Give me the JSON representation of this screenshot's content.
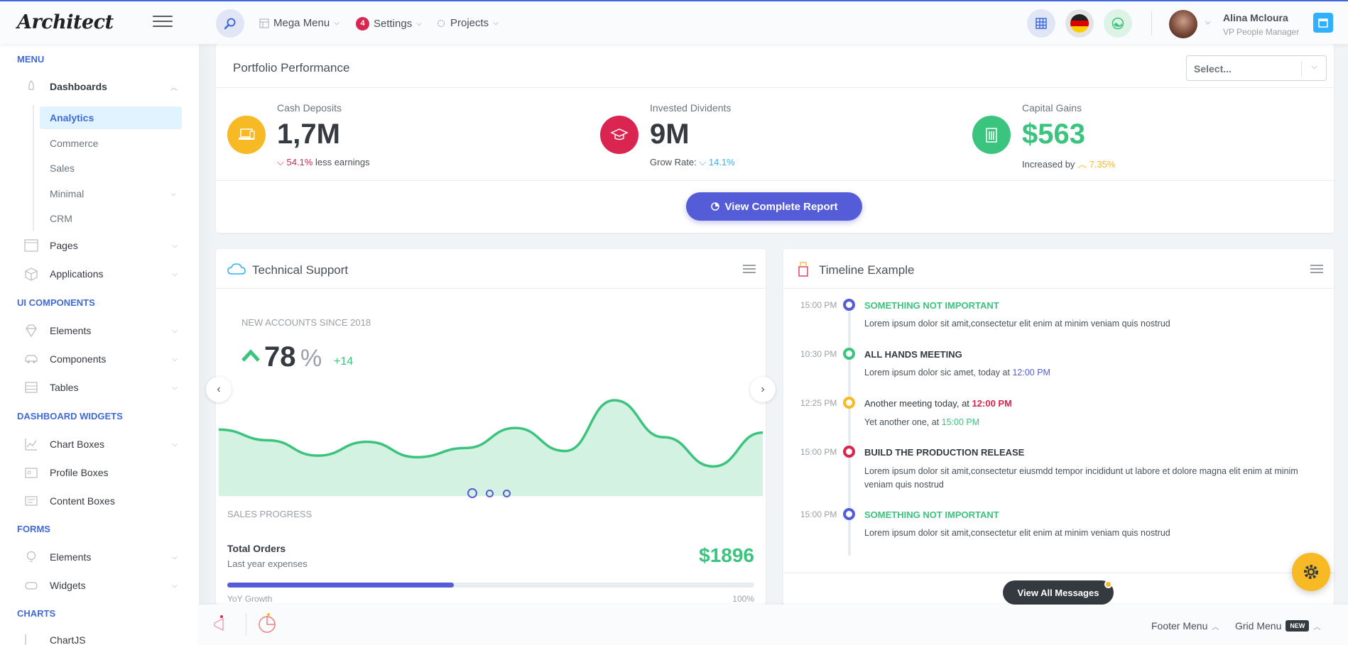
{
  "app": {
    "logo": "Architect"
  },
  "header": {
    "mega_menu": "Mega Menu",
    "settings": "Settings",
    "settings_badge": "4",
    "projects": "Projects",
    "user_name": "Alina Mcloura",
    "user_role": "VP People Manager"
  },
  "sidebar": {
    "sections": {
      "menu": "MENU",
      "ui_components": "UI COMPONENTS",
      "dashboard_widgets": "DASHBOARD WIDGETS",
      "forms": "FORMS",
      "charts": "CHARTS"
    },
    "dashboards": "Dashboards",
    "dashboard_sub": [
      "Analytics",
      "Commerce",
      "Sales",
      "Minimal",
      "CRM"
    ],
    "pages": "Pages",
    "applications": "Applications",
    "elements": "Elements",
    "components": "Components",
    "tables": "Tables",
    "chart_boxes": "Chart Boxes",
    "profile_boxes": "Profile Boxes",
    "content_boxes": "Content Boxes",
    "form_elements": "Elements",
    "widgets": "Widgets",
    "chartjs": "ChartJS"
  },
  "portfolio": {
    "title": "Portfolio Performance",
    "select_placeholder": "Select...",
    "metrics": [
      {
        "label": "Cash Deposits",
        "value": "1,7M",
        "change": "54.1%",
        "change_text": " less earnings"
      },
      {
        "label": "Invested Dividents",
        "value": "9M",
        "prefix": "Grow Rate:",
        "change": "14.1%"
      },
      {
        "label": "Capital Gains",
        "value": "$563",
        "prefix": "Increased by",
        "change": "7.35%"
      }
    ],
    "report_button": "View Complete Report"
  },
  "support": {
    "title": "Technical Support",
    "accounts_label": "NEW ACCOUNTS SINCE 2018",
    "accounts_value": "78",
    "accounts_unit": "%",
    "accounts_delta": "+14",
    "sales_progress": "SALES PROGRESS",
    "total_orders": "Total Orders",
    "last_year": "Last year expenses",
    "amount": "$1896",
    "yoy": "YoY Growth",
    "yoy_pct": "100%",
    "progress": 0.43
  },
  "chart_data": {
    "type": "area",
    "title": "",
    "values": [
      54,
      47,
      37,
      46,
      36,
      42,
      55,
      40,
      73,
      49,
      30,
      52
    ],
    "color": "#3ac47d"
  },
  "timeline": {
    "title": "Timeline Example",
    "items": [
      {
        "time": "15:00 PM",
        "title": "SOMETHING NOT IMPORTANT",
        "text": "Lorem ipsum dolor sit amit,consectetur elit enim at minim veniam quis nostrud"
      },
      {
        "time": "10:30 PM",
        "title": "ALL HANDS MEETING",
        "text": "Lorem ipsum dolor sic amet, today at",
        "time_link": "12:00 PM"
      },
      {
        "time": "12:25 PM",
        "title": "Another meeting today, at",
        "title_time": "12:00 PM",
        "text": "Yet another one, at",
        "time_link": "15:00 PM"
      },
      {
        "time": "15:00 PM",
        "title": "BUILD THE PRODUCTION RELEASE",
        "text": "Lorem ipsum dolor sit amit,consectetur eiusmdd tempor incididunt ut labore et dolore magna elit enim at minim veniam quis nostrud"
      },
      {
        "time": "15:00 PM",
        "title": "SOMETHING NOT IMPORTANT",
        "text": "Lorem ipsum dolor sit amit,consectetur elit enim at minim veniam quis nostrud"
      }
    ],
    "view_all": "View All Messages"
  },
  "footer": {
    "footer_menu": "Footer Menu",
    "grid_menu": "Grid Menu",
    "new_badge": "NEW"
  },
  "colors": {
    "primary": "#545cd8",
    "success": "#3ac47d",
    "danger": "#d92550",
    "warning": "#f7b924",
    "info": "#30b1ff"
  }
}
